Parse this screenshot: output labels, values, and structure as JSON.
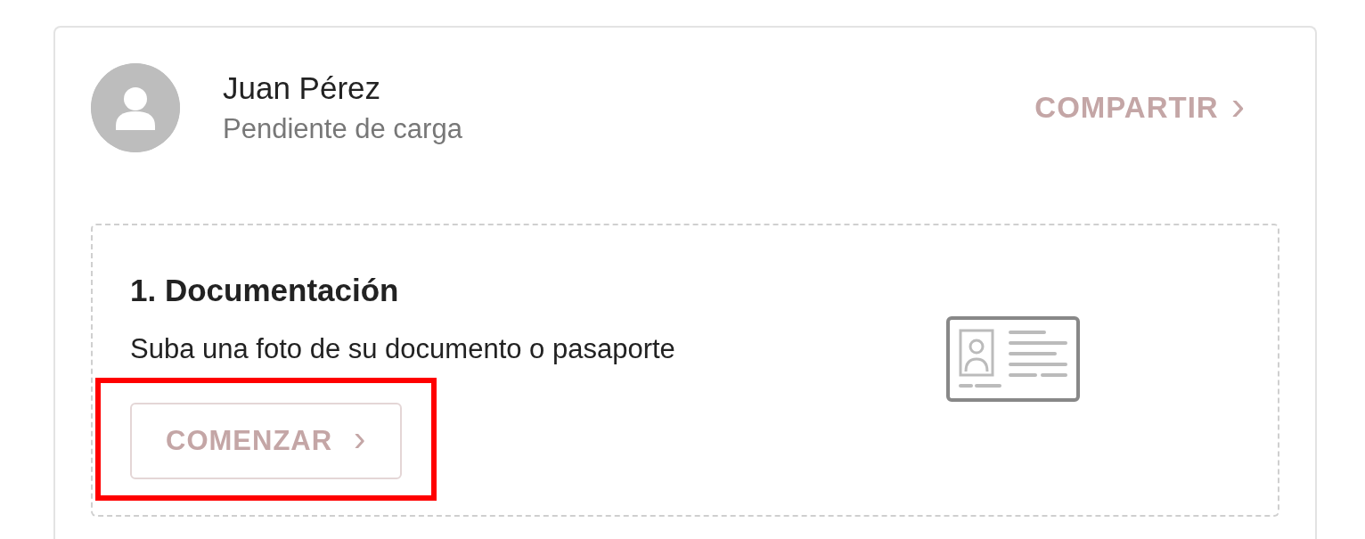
{
  "profile": {
    "name": "Juan Pérez",
    "status": "Pendiente de carga"
  },
  "share_link": {
    "label": "COMPARTIR",
    "chevron": "›"
  },
  "steps": [
    {
      "title": "1. Documentación",
      "description": "Suba una foto de su documento o pasaporte",
      "button": {
        "label": "COMENZAR",
        "chevron": "›",
        "highlighted": true
      }
    }
  ]
}
